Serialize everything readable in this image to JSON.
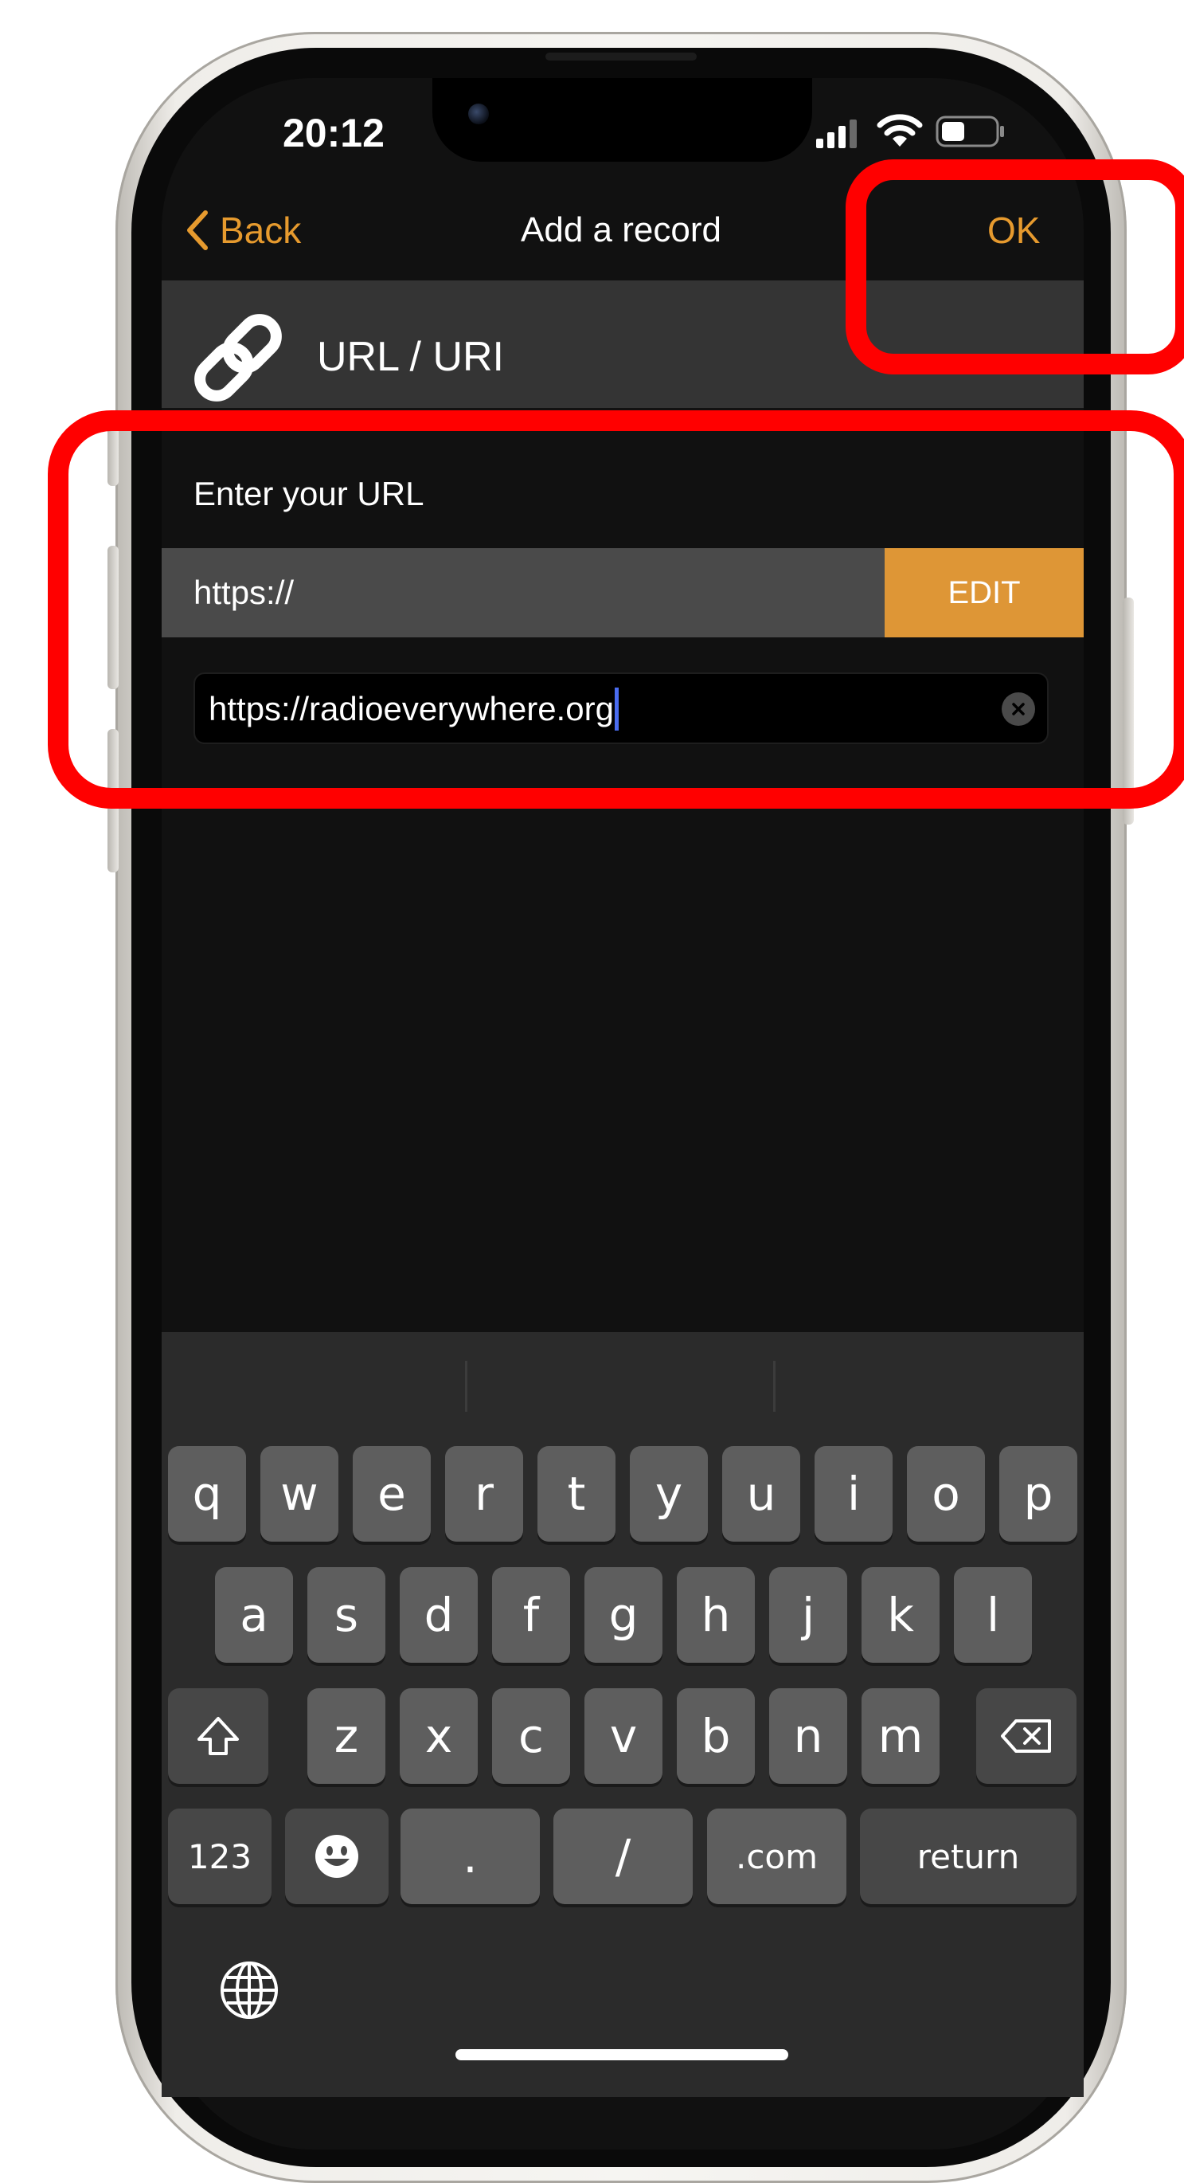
{
  "status": {
    "time": "20:12"
  },
  "nav": {
    "back_label": "Back",
    "title": "Add a record",
    "ok_label": "OK"
  },
  "record_type": {
    "label": "URL / URI",
    "icon": "link-icon"
  },
  "form": {
    "section_label": "Enter your URL",
    "prefix": "https://",
    "edit_label": "EDIT",
    "url_value": "https://radioeverywhere.org"
  },
  "keyboard": {
    "row1": [
      "q",
      "w",
      "e",
      "r",
      "t",
      "y",
      "u",
      "i",
      "o",
      "p"
    ],
    "row2": [
      "a",
      "s",
      "d",
      "f",
      "g",
      "h",
      "j",
      "k",
      "l"
    ],
    "row3": [
      "z",
      "x",
      "c",
      "v",
      "b",
      "n",
      "m"
    ],
    "numbers_label": "123",
    "period": ".",
    "slash": "/",
    "dotcom": ".com",
    "return_label": "return"
  },
  "colors": {
    "accent": "#e69a2e",
    "edit_bg": "#de9636",
    "highlight": "#ff0000"
  }
}
